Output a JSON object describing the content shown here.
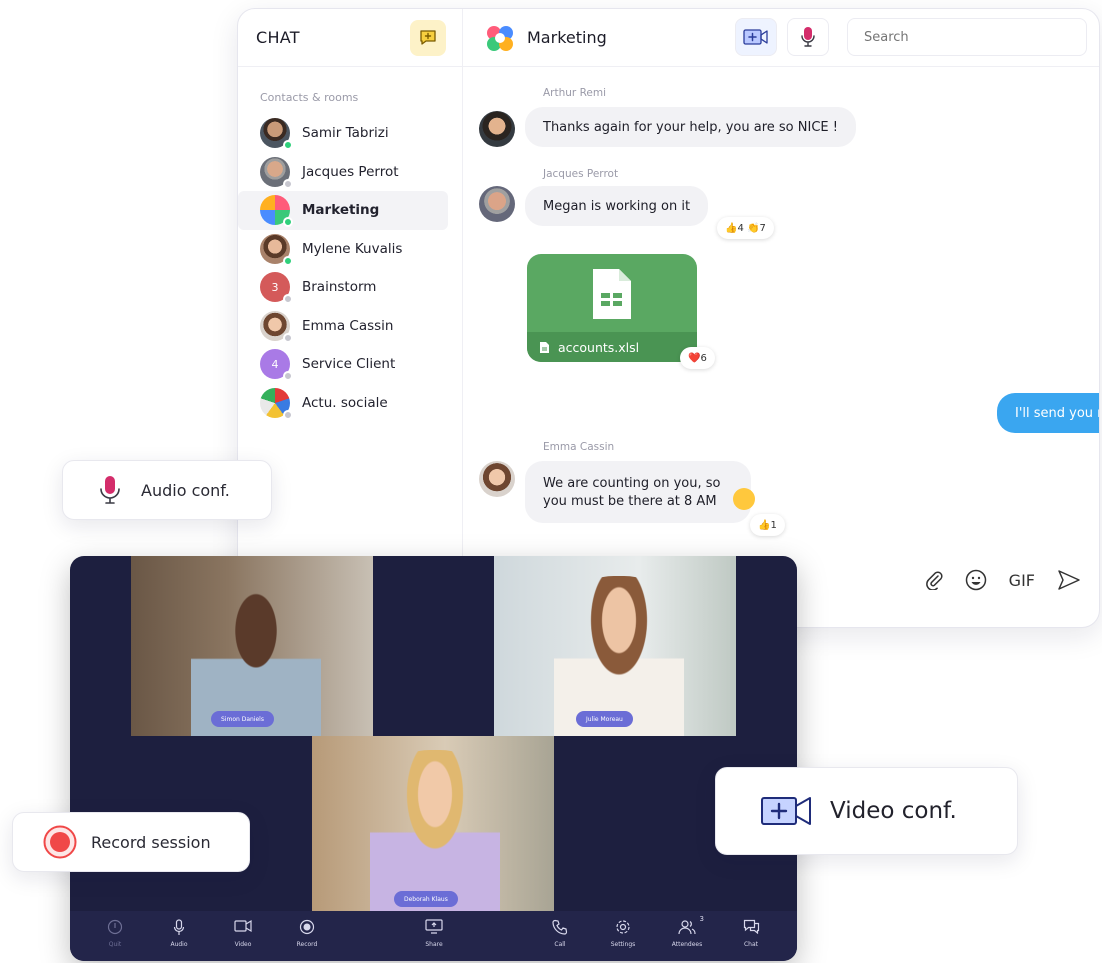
{
  "chat": {
    "title": "CHAT",
    "contacts_label": "Contacts & rooms",
    "contacts": [
      {
        "name": "Samir Tabrizi",
        "status": "online"
      },
      {
        "name": "Jacques Perrot",
        "status": "offline"
      },
      {
        "name": "Marketing",
        "status": "online",
        "active": true
      },
      {
        "name": "Mylene Kuvalis",
        "status": "online"
      },
      {
        "name": "Brainstorm",
        "badge": "3",
        "status": "offline"
      },
      {
        "name": "Emma Cassin",
        "status": "offline"
      },
      {
        "name": "Service Client",
        "badge": "4",
        "status": "offline"
      },
      {
        "name": "Actu. sociale",
        "status": "offline"
      }
    ],
    "room_title": "Marketing",
    "search_placeholder": "Search",
    "messages": [
      {
        "sender": "Arthur Remi",
        "text": "Thanks again for your help, you are so NICE !"
      },
      {
        "sender": "Jacques Perrot",
        "text": "Megan is working on it",
        "reactions": "👍4 👏7"
      },
      {
        "file": "accounts.xlsl",
        "reactions": "❤️6"
      },
      {
        "mine": true,
        "text": "I'll send you my feedback. I Promise"
      },
      {
        "sender": "Emma Cassin",
        "text_line1": "We are counting on you, so",
        "text_line2": "you must be there at 8 AM",
        "reactions": "👍1"
      }
    ],
    "gif_label": "GIF"
  },
  "cards": {
    "audio": "Audio conf.",
    "video": "Video conf.",
    "record": "Record session"
  },
  "video": {
    "participants": [
      "Simon Daniels",
      "Julie Moreau",
      "Deborah Klaus"
    ],
    "controls": [
      "Quit",
      "Audio",
      "Video",
      "Record",
      "Share",
      "Call",
      "Settings",
      "Attendees",
      "Chat"
    ],
    "attendees_count": "3"
  },
  "colors": {
    "accent_blue": "#3aa6f0",
    "online": "#2fd07b",
    "video_bg": "#1d1f3f",
    "record_red": "#f04848",
    "mic_pink": "#d42d6b"
  }
}
